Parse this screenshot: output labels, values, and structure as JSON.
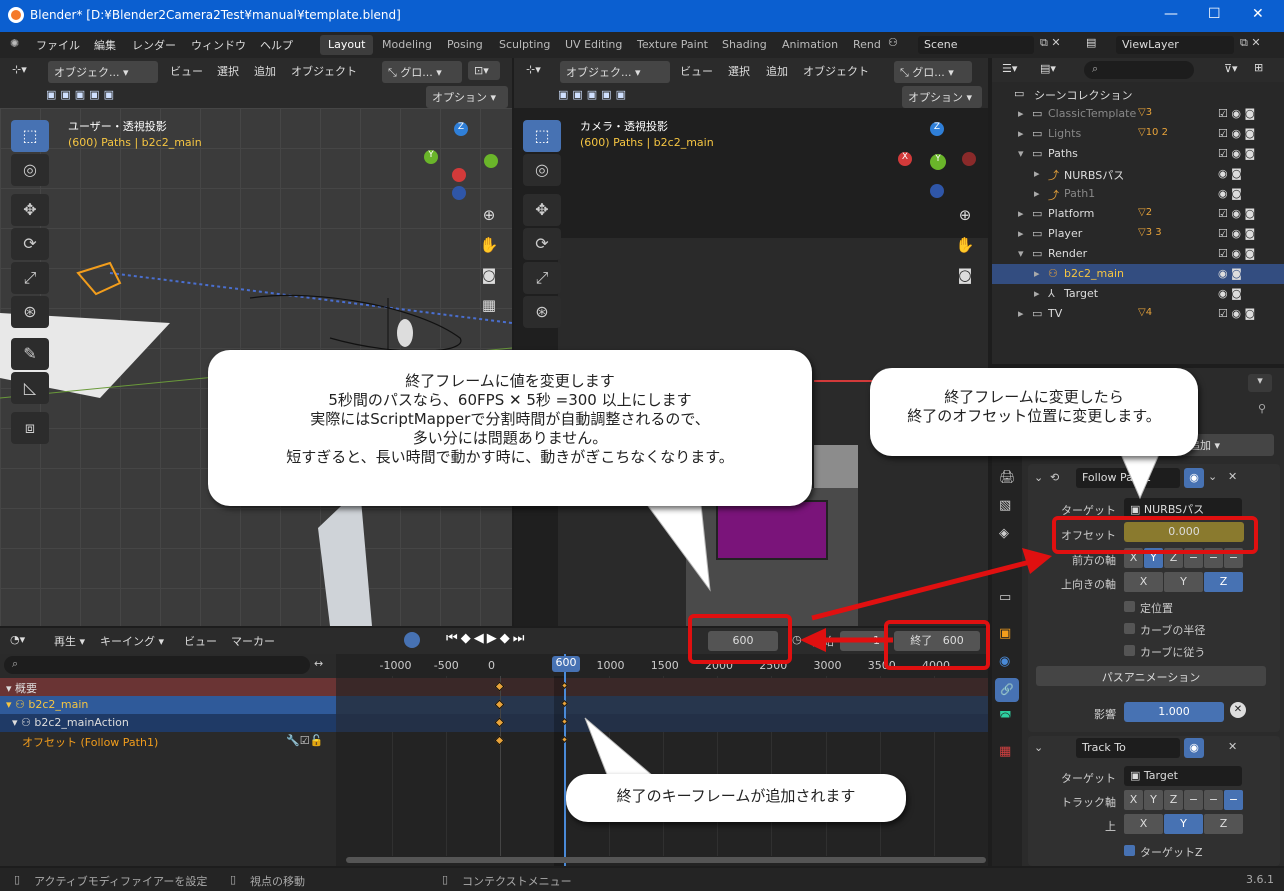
{
  "window": {
    "title": "Blender* [D:¥Blender2Camera2Test¥manual¥template.blend]"
  },
  "menu": [
    "ファイル",
    "編集",
    "レンダー",
    "ウィンドウ",
    "ヘルプ"
  ],
  "workspaces": [
    "Layout",
    "Modeling",
    "Posing",
    "Sculpting",
    "UV Editing",
    "Texture Paint",
    "Shading",
    "Animation",
    "Rend"
  ],
  "scene": "Scene",
  "view_layer": "ViewLayer",
  "viewport_left": {
    "mode": "オブジェク...",
    "menu": [
      "ビュー",
      "選択",
      "追加",
      "オブジェクト"
    ],
    "orient": "グロ...",
    "options": "オプション",
    "title": "ユーザー・透視投影",
    "sub": "(600) Paths | b2c2_main"
  },
  "viewport_right": {
    "mode": "オブジェク...",
    "menu": [
      "ビュー",
      "選択",
      "追加",
      "オブジェクト"
    ],
    "orient": "グロ...",
    "options": "オプション",
    "title": "カメラ・透視投影",
    "sub": "(600) Paths | b2c2_main"
  },
  "outliner": {
    "root": "シーンコレクション",
    "items": [
      {
        "label": "ClassicTemplate",
        "badge": "3"
      },
      {
        "label": "Lights",
        "badge": "10 2"
      },
      {
        "label": "Paths",
        "badge": ""
      },
      {
        "label": "NURBSパス",
        "badge": ""
      },
      {
        "label": "Path1",
        "badge": ""
      },
      {
        "label": "Platform",
        "badge": "2"
      },
      {
        "label": "Player",
        "badge": "3 3"
      },
      {
        "label": "Render",
        "badge": ""
      },
      {
        "label": "b2c2_main",
        "badge": ""
      },
      {
        "label": "Target",
        "badge": ""
      },
      {
        "label": "TV",
        "badge": "4"
      }
    ]
  },
  "properties": {
    "add_label": "を追加",
    "c1_name": "Follow Path1",
    "target_label": "ターゲット",
    "target_value": "NURBSパス",
    "offset_label": "オフセット",
    "offset_value": "0.000",
    "forward_label": "前方の軸",
    "forward_axes": [
      "X",
      "Y",
      "Z",
      "−",
      "−",
      "−"
    ],
    "up_label": "上向きの軸",
    "up_axes": [
      "X",
      "Y",
      "Z"
    ],
    "fixed": "定位置",
    "curve_radius": "カーブの半径",
    "follow_curve": "カーブに従う",
    "path_anim": "パスアニメーション",
    "influence_label": "影響",
    "influence_value": "1.000",
    "c2_name": "Track To",
    "c2_target_label": "ターゲット",
    "c2_target_value": "Target",
    "track_axis_label": "トラック軸",
    "track_axes": [
      "X",
      "Y",
      "Z",
      "−",
      "−",
      "−"
    ],
    "c2_up_label": "上",
    "c2_up_axes": [
      "X",
      "Y",
      "Z"
    ],
    "target_z": "ターゲットZ"
  },
  "timeline": {
    "menu": [
      "再生",
      "キーイング",
      "ビュー",
      "マーカー"
    ],
    "current_frame": "600",
    "start_label": "開始",
    "start_value": "1",
    "end_label": "終了",
    "end_value": "600",
    "ruler": [
      "-1000",
      "-500",
      "0",
      "600",
      "1000",
      "1500",
      "2000",
      "2500",
      "3000",
      "3500",
      "4000"
    ],
    "channels": [
      "概要",
      "b2c2_main",
      "b2c2_mainAction",
      "オフセット (Follow Path1)"
    ]
  },
  "statusbar": {
    "items": [
      "アクティブモディファイアーを設定",
      "視点の移動",
      "コンテクストメニュー"
    ],
    "version": "3.6.1"
  },
  "callouts": {
    "main": [
      "終了フレームに値を変更します",
      "5秒間のパスなら、60FPS ✕ 5秒 =300 以上にします",
      "実際にはScriptMapperで分割時間が自動調整されるので、",
      "多い分には問題ありません。",
      "短すぎると、長い時間で動かす時に、動きがぎこちなくなります。"
    ],
    "right": [
      "終了フレームに変更したら",
      "終了のオフセット位置に変更します。"
    ],
    "bottom": "終了のキーフレームが追加されます"
  },
  "colors": {
    "accent": "#4772b3",
    "offset_field": "#8a7a2e",
    "annotation_red": "#e01010",
    "keyframe": "#e8a33a"
  }
}
